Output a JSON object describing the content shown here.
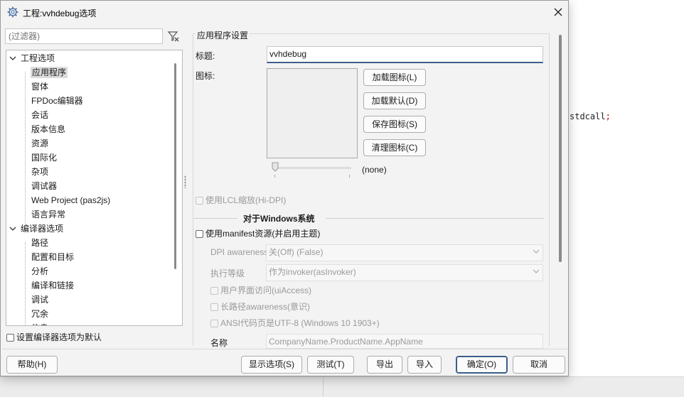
{
  "background_code": {
    "text": "stdcall",
    "semicolon": ";"
  },
  "window": {
    "title": "工程:vvhdebug选项"
  },
  "filter": {
    "placeholder": "(过滤器)"
  },
  "tree": {
    "groups": [
      {
        "label": "工程选项",
        "items": [
          "应用程序",
          "窗体",
          "FPDoc编辑器",
          "会话",
          "版本信息",
          "资源",
          "国际化",
          "杂项",
          "调试器",
          "Web Project (pas2js)",
          "语言异常"
        ]
      },
      {
        "label": "编译器选项",
        "items": [
          "路径",
          "配置和目标",
          "分析",
          "编译和链接",
          "调试",
          "冗余",
          "信息"
        ]
      }
    ],
    "selected": "应用程序"
  },
  "set_default_checkbox": {
    "label": "设置编译器选项为默认"
  },
  "app_settings": {
    "group_title": "应用程序设置",
    "title_label": "标题:",
    "title_value": "vvhdebug",
    "icon_label": "图标:",
    "buttons": {
      "load_icon": "加载图标(L)",
      "load_default": "加载默认(D)",
      "save_icon": "保存图标(S)",
      "clear_icon": "清理图标(C)"
    },
    "icon_size": "(none)",
    "lcl_scaling": "使用LCL缩放(Hi-DPI)"
  },
  "windows": {
    "section_title": "对于Windows系统",
    "manifest_checkbox": "使用manifest资源(并启用主题)",
    "dpi_label": "DPI awareness",
    "dpi_value": "关(Off) (False)",
    "exec_level_label": "执行等级",
    "exec_level_value": "作为invoker(asInvoker)",
    "ui_access": "用户界面访问(uiAccess)",
    "long_path": "长路径awareness(意识)",
    "ansi_utf8": "ANSI代码页是UTF-8 (Windows 10 1903+)",
    "name_label": "名称",
    "name_value": "CompanyName.ProductName.AppName"
  },
  "footer": {
    "help": "帮助(H)",
    "show_options": "显示选项(S)",
    "test": "测试(T)",
    "export": "导出",
    "import": "导入",
    "ok": "确定(O)",
    "cancel": "取消"
  }
}
